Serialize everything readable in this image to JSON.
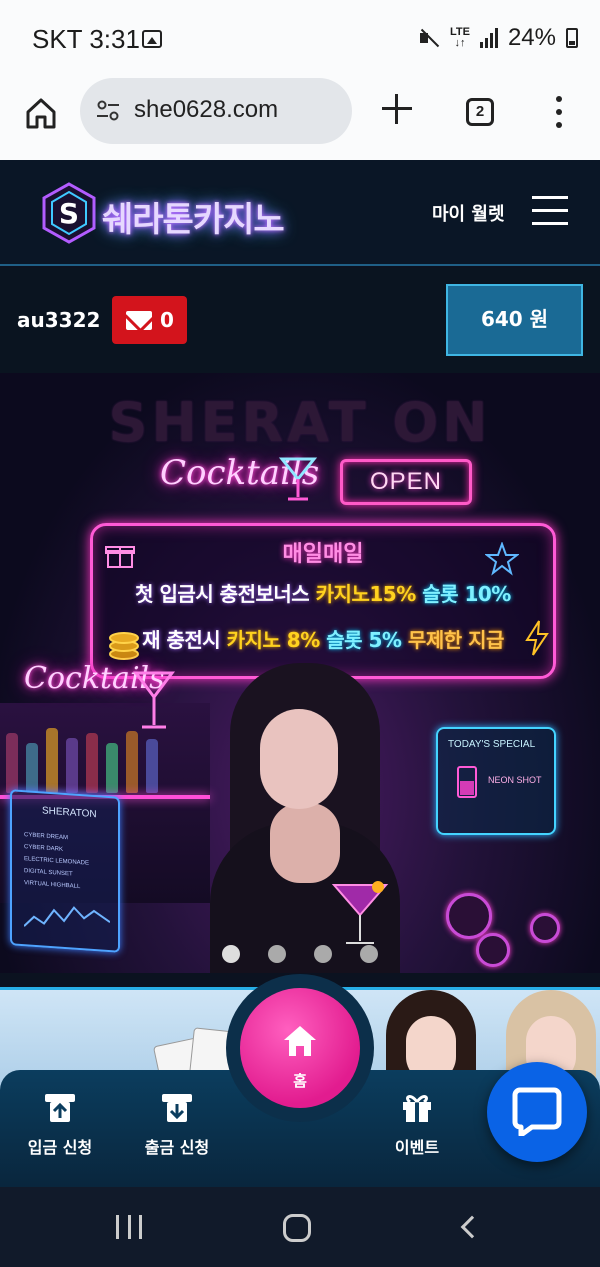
{
  "status_bar": {
    "carrier_time": "SKT 3:31",
    "network": "LTE",
    "battery": "24%"
  },
  "browser": {
    "url": "she0628.com",
    "tab_count": "2"
  },
  "header": {
    "logo_text": "쉐라톤카지노",
    "wallet_label": "마이 월렛"
  },
  "user": {
    "username": "au3322",
    "message_count": "0",
    "balance": "640 원"
  },
  "banner": {
    "watermark": "SHERAT ON",
    "cocktails_top": "Cocktails",
    "open_sign": "OPEN",
    "promo_title": "매일매일",
    "line1_a": "첫 입금시 충전보너스",
    "line1_b": "카지노15%",
    "line1_c": "슬롯 10%",
    "line2_a": "재 충전시",
    "line2_b": "카지노 8%",
    "line2_c": "슬롯 5%",
    "line2_d": "무제한 지급",
    "cocktails_side": "Cocktails",
    "special_title": "TODAY'S SPECIAL",
    "special_item": "NEON SHOT",
    "menu_title": "SHERATON",
    "menu_items": [
      "CYBER DREAM",
      "CYBER DARK",
      "ELECTRIC LEMONADE",
      "DIGITAL SUNSET",
      "VIRTUAL HIGHBALL"
    ],
    "slide_count": 4,
    "active_slide": 1
  },
  "bottom_nav": {
    "deposit": "입금 신청",
    "withdraw": "출금 신청",
    "home": "홈",
    "event": "이벤트"
  },
  "colors": {
    "accent_pink": "#e21c8f",
    "balance_blue": "#1a6a95",
    "mail_red": "#d3141c",
    "chat_blue": "#0a63e6"
  }
}
